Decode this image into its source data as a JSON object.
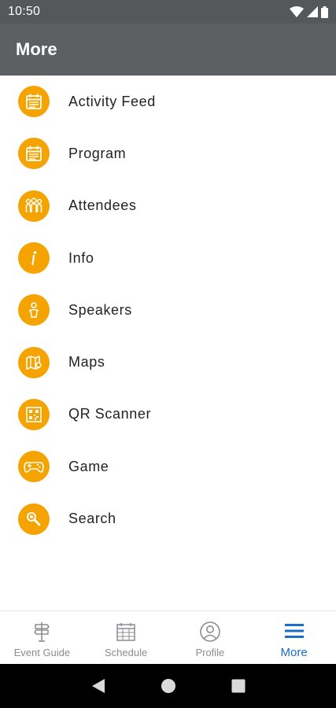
{
  "status_bar": {
    "time": "10:50"
  },
  "app_bar": {
    "title": "More"
  },
  "menu": {
    "items": [
      {
        "label": "Activity Feed",
        "icon": "calendar-icon"
      },
      {
        "label": "Program",
        "icon": "calendar-icon"
      },
      {
        "label": "Attendees",
        "icon": "people-icon"
      },
      {
        "label": "Info",
        "icon": "info-icon"
      },
      {
        "label": "Speakers",
        "icon": "speaker-icon"
      },
      {
        "label": "Maps",
        "icon": "map-icon"
      },
      {
        "label": "QR Scanner",
        "icon": "qr-code-icon"
      },
      {
        "label": "Game",
        "icon": "gamepad-icon"
      },
      {
        "label": "Search",
        "icon": "search-icon"
      }
    ]
  },
  "bottom_nav": {
    "items": [
      {
        "label": "Event Guide",
        "icon": "signpost-icon",
        "active": false
      },
      {
        "label": "Schedule",
        "icon": "calendar-icon",
        "active": false
      },
      {
        "label": "Profile",
        "icon": "profile-icon",
        "active": false
      },
      {
        "label": "More",
        "icon": "hamburger-menu-icon",
        "active": true
      }
    ]
  },
  "colors": {
    "accent": "#f5a300",
    "app_bar": "#5d6063",
    "status_bar": "#55585b",
    "active_nav": "#1a6fc4",
    "inactive_nav": "#8a8d90"
  }
}
